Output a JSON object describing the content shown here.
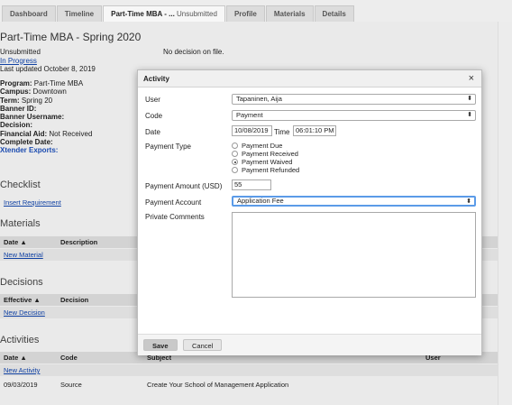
{
  "tabs": [
    {
      "label": "Dashboard"
    },
    {
      "label": "Timeline"
    },
    {
      "label": "Part-Time MBA - ...",
      "suffix": "Unsubmitted"
    },
    {
      "label": "Profile"
    },
    {
      "label": "Materials"
    },
    {
      "label": "Details"
    }
  ],
  "page": {
    "title": "Part-Time MBA - Spring 2020",
    "status": "Unsubmitted",
    "progress_link": "In Progress",
    "updated": "Last updated October 8, 2019",
    "decision_note": "No decision on file."
  },
  "fields": {
    "program_label": "Program:",
    "program": "Part-Time MBA",
    "campus_label": "Campus:",
    "campus": "Downtown",
    "term_label": "Term:",
    "term": "Spring 20",
    "banner_id_label": "Banner ID:",
    "banner_user_label": "Banner Username:",
    "decision_label": "Decision:",
    "finaid_label": "Financial Aid:",
    "finaid": "Not Received",
    "complete_label": "Complete Date:",
    "xtender_label": "Xtender Exports:"
  },
  "checklist": {
    "title": "Checklist",
    "link": "Insert Requirement"
  },
  "materials": {
    "title": "Materials",
    "col_date": "Date ▲",
    "col_desc": "Description",
    "link": "New Material"
  },
  "decisions": {
    "title": "Decisions",
    "col_eff": "Effective ▲",
    "col_dec": "Decision",
    "link": "New Decision"
  },
  "activities": {
    "title": "Activities",
    "col_date": "Date ▲",
    "col_code": "Code",
    "col_subject": "Subject",
    "col_user": "User",
    "link": "New Activity",
    "rows": [
      {
        "date": "09/03/2019",
        "code": "Source",
        "subject": "Create Your School of Management Application"
      }
    ]
  },
  "modal": {
    "title": "Activity",
    "close_glyph": "×",
    "user_label": "User",
    "user_value": "Tapaninen, Aija",
    "code_label": "Code",
    "code_value": "Payment",
    "date_label": "Date",
    "date_value": "10/08/2019",
    "time_label": "Time",
    "time_value": "06:01:10 PM",
    "ptype_label": "Payment Type",
    "ptype_options": [
      "Payment Due",
      "Payment Received",
      "Payment Waived",
      "Payment Refunded"
    ],
    "ptype_selected": "Payment Waived",
    "amount_label": "Payment Amount (USD)",
    "amount_value": "55",
    "account_label": "Payment Account",
    "account_value": "Application Fee",
    "comments_label": "Private Comments",
    "save_label": "Save",
    "cancel_label": "Cancel",
    "select_arrows": "⬍"
  }
}
